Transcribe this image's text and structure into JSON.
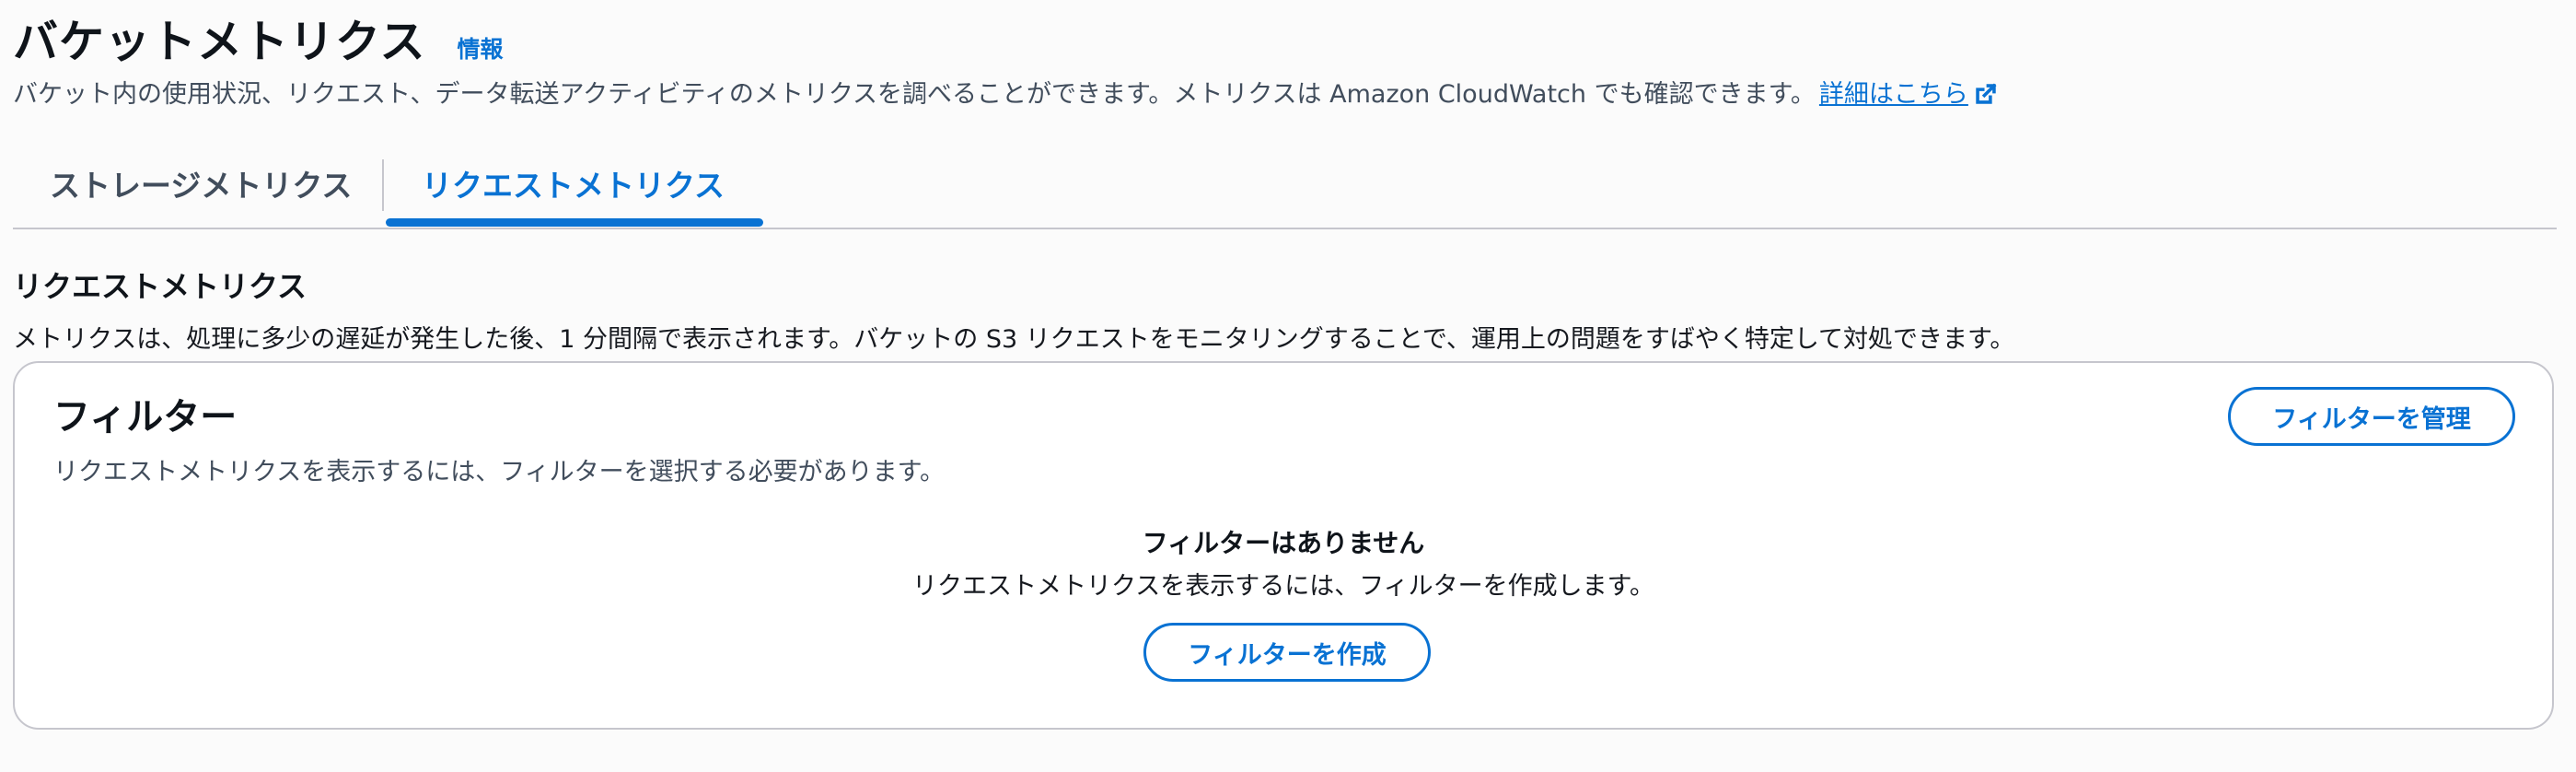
{
  "header": {
    "title": "バケットメトリクス",
    "info_link": "情報",
    "description": "バケット内の使用状況、リクエスト、データ転送アクティビティのメトリクスを調べることができます。メトリクスは Amazon CloudWatch でも確認できます。",
    "detail_link": "詳細はこちら",
    "detail_link_icon": "external-link-icon"
  },
  "tabs": [
    {
      "label": "ストレージメトリクス",
      "active": false
    },
    {
      "label": "リクエストメトリクス",
      "active": true
    }
  ],
  "section": {
    "title": "リクエストメトリクス",
    "description": "メトリクスは、処理に多少の遅延が発生した後、1 分間隔で表示されます。バケットの S3 リクエストをモニタリングすることで、運用上の問題をすばやく特定して対処できます。"
  },
  "filters": {
    "title": "フィルター",
    "description": "リクエストメトリクスを表示するには、フィルターを選択する必要があります。",
    "manage_button": "フィルターを管理",
    "empty_title": "フィルターはありません",
    "empty_description": "リクエストメトリクスを表示するには、フィルターを作成します。",
    "create_button": "フィルターを作成"
  },
  "colors": {
    "accent": "#0972d3",
    "text_primary": "#0f141a",
    "text_secondary": "#414d5c",
    "border": "#c6c6cd",
    "background": "#fbfbfb"
  }
}
